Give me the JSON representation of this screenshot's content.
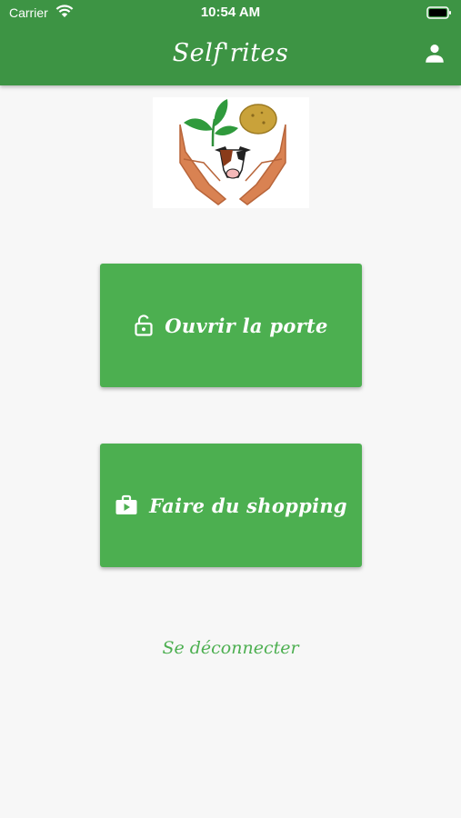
{
  "status_bar": {
    "carrier": "Carrier",
    "time": "10:54 AM",
    "wifi_icon": "wifi-icon",
    "battery_icon": "battery-icon"
  },
  "header": {
    "title": "Self'rites",
    "profile_icon": "person-icon",
    "background_color": "#3d9444"
  },
  "logo": {
    "icon": "farm-logo"
  },
  "actions": {
    "open_door": {
      "label": "Ouvrir la porte",
      "icon": "lock-open-icon"
    },
    "shopping": {
      "label": "Faire du shopping",
      "icon": "shopping-bag-icon"
    },
    "button_color": "#4caf50"
  },
  "logout": {
    "label": "Se déconnecter"
  }
}
